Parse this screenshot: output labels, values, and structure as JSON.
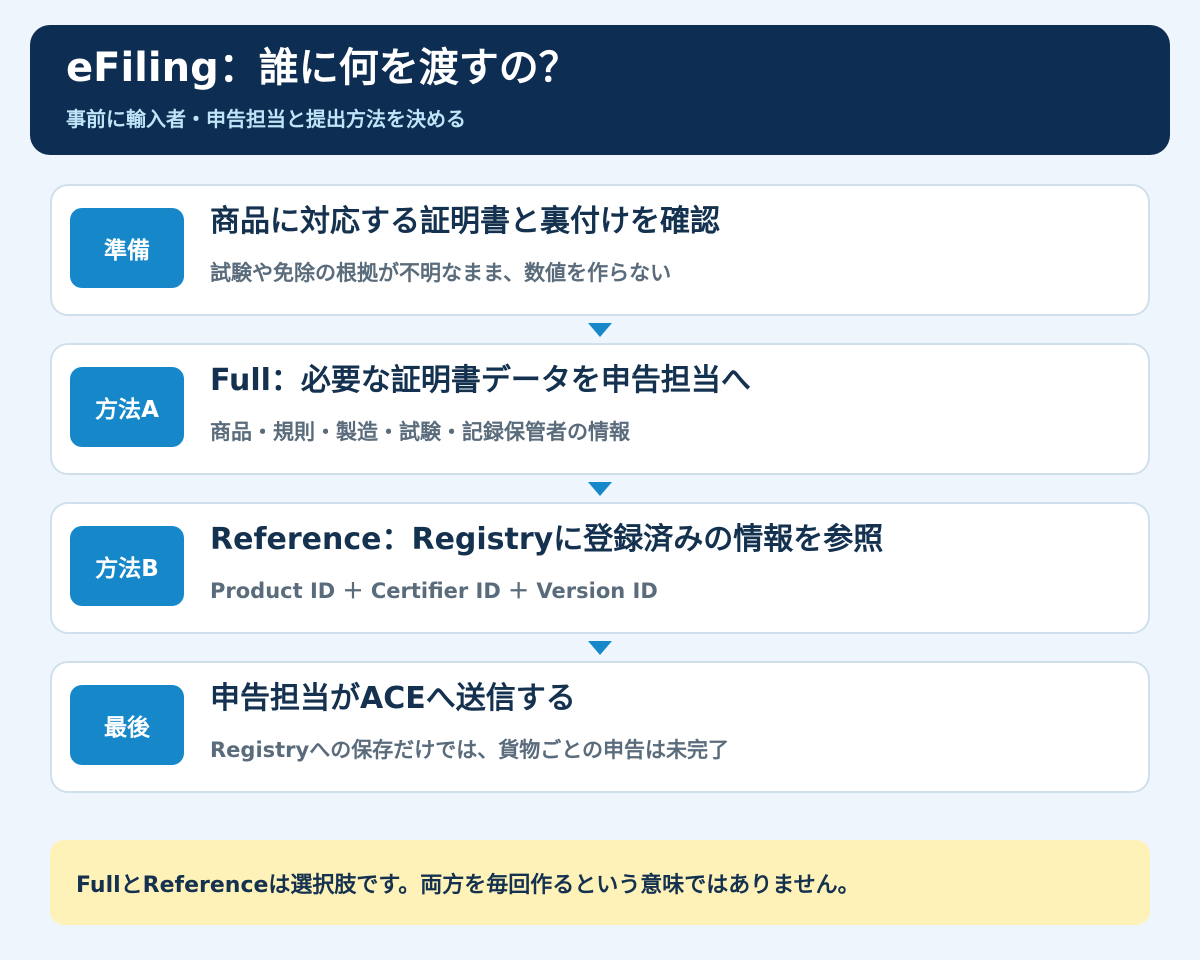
{
  "header": {
    "title": "eFiling：誰に何を渡すの？",
    "subtitle": "事前に輸入者・申告担当と提出方法を決める"
  },
  "steps": [
    {
      "badge": "準備",
      "title": "商品に対応する証明書と裏付けを確認",
      "description": "試験や免除の根拠が不明なまま、数値を作らない"
    },
    {
      "badge": "方法A",
      "title": "Full：必要な証明書データを申告担当へ",
      "description": "商品・規則・製造・試験・記録保管者の情報"
    },
    {
      "badge": "方法B",
      "title": "Reference：Registryに登録済みの情報を参照",
      "description": "Product ID ＋ Certifier ID ＋ Version ID"
    },
    {
      "badge": "最後",
      "title": "申告担当がACEへ送信する",
      "description": "Registryへの保存だけでは、貨物ごとの申告は未完了"
    }
  ],
  "note": {
    "text": "FullとReferenceは選択肢です。両方を毎回作るという意味ではありません。"
  },
  "colors": {
    "header_bg": "#0d2d52",
    "badge_bg": "#1688c9",
    "note_bg": "#fff2b8",
    "page_bg": "#eef5fc"
  }
}
